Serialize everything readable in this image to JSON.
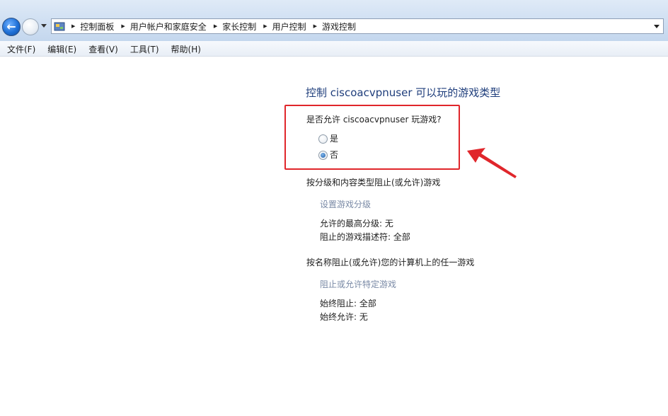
{
  "breadcrumb": {
    "items": [
      "控制面板",
      "用户帐户和家庭安全",
      "家长控制",
      "用户控制",
      "游戏控制"
    ]
  },
  "menu": {
    "items": [
      "文件(F)",
      "编辑(E)",
      "查看(V)",
      "工具(T)",
      "帮助(H)"
    ]
  },
  "page": {
    "title": "控制 ciscoacvpnuser 可以玩的游戏类型",
    "question": "是否允许 ciscoacvpnuser 玩游戏?",
    "options": [
      {
        "label": "是",
        "checked": false
      },
      {
        "label": "否",
        "checked": true
      }
    ],
    "section_rating": {
      "title": "按分级和内容类型阻止(或允许)游戏",
      "link": "设置游戏分级",
      "line1": "允许的最高分级:  无",
      "line2": "阻止的游戏描述符: 全部"
    },
    "section_name": {
      "title": "按名称阻止(或允许)您的计算机上的任一游戏",
      "link": "阻止或允许特定游戏",
      "line1": "始终阻止: 全部",
      "line2": "始终允许: 无"
    }
  },
  "colors": {
    "title": "#1e3d7b",
    "link_disabled": "#7a8aa6",
    "annotation_red": "#e0262b"
  }
}
